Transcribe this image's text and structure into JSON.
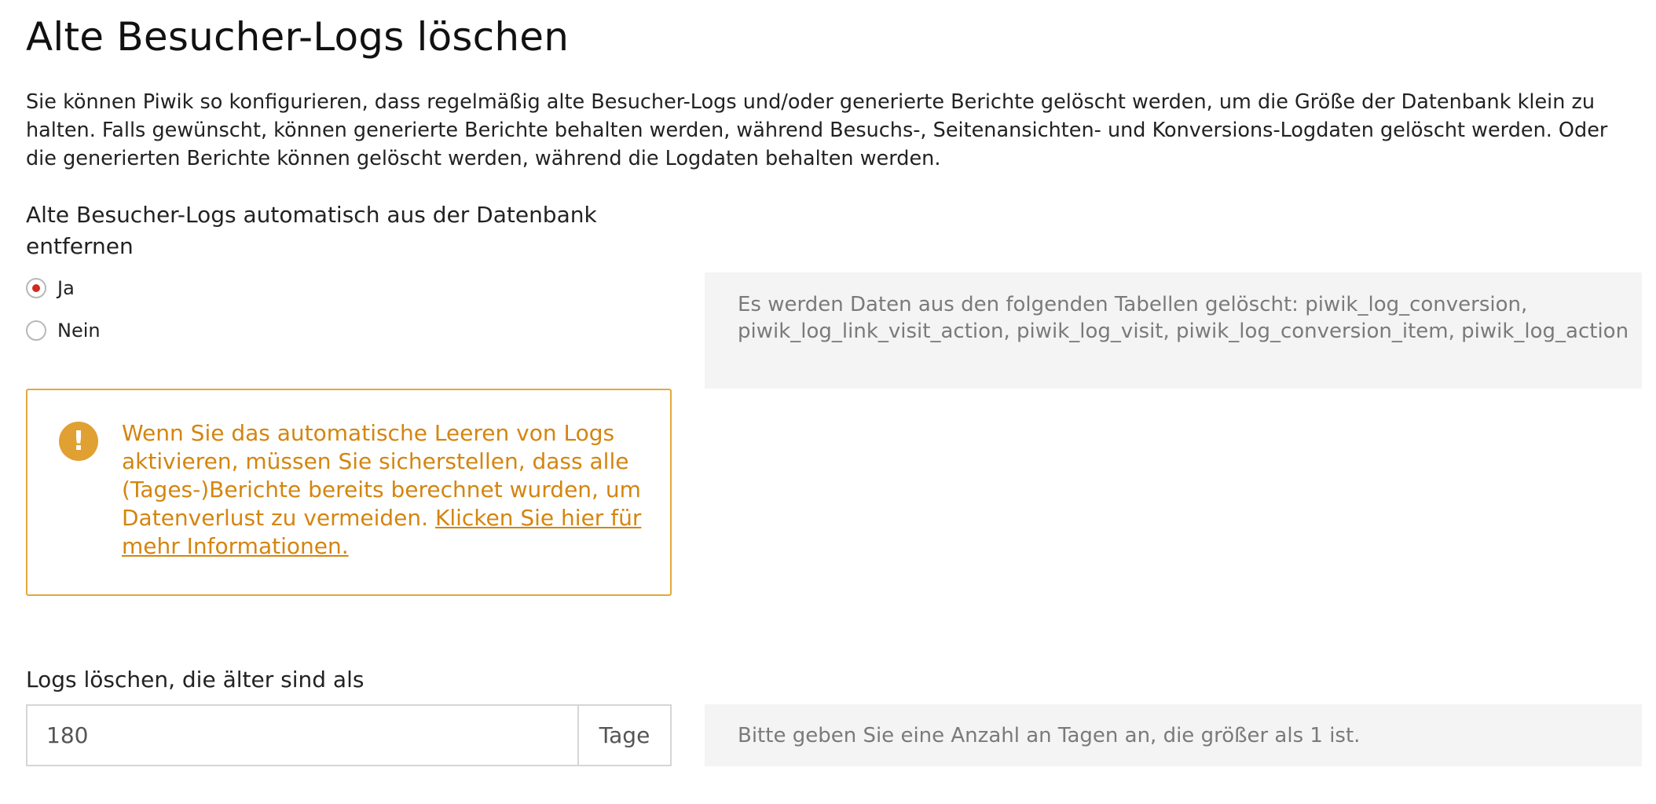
{
  "page": {
    "title": "Alte Besucher-Logs löschen",
    "intro": "Sie können Piwik so konfigurieren, dass regelmäßig alte Besucher-Logs und/oder generierte Berichte gelöscht werden, um die Größe der Datenbank klein zu halten. Falls gewünscht, können generierte Berichte behalten werden, während Besuchs-, Seitenansichten- und Konversions-Logdaten gelöscht werden. Oder die generierten Berichte können gelöscht werden, während die Logdaten behalten werden."
  },
  "delete_logs": {
    "label": "Alte Besucher-Logs automatisch aus der Datenbank entfernen",
    "options": [
      {
        "label": "Ja",
        "selected": true
      },
      {
        "label": "Nein",
        "selected": false
      }
    ],
    "tables_info": "Es werden Daten aus den folgenden Tabellen gelöscht: piwik_log_conversion, piwik_log_link_visit_action, piwik_log_visit, piwik_log_conversion_item, piwik_log_action"
  },
  "warning": {
    "icon": "exclamation-icon",
    "text": "Wenn Sie das automatische Leeren von Logs aktivieren, müssen Sie sicherstellen, dass alle (Tages-)Berichte bereits berechnet wurden, um Datenverlust zu vermeiden.",
    "link": "Klicken Sie hier für mehr Informationen."
  },
  "older_than": {
    "label": "Logs löschen, die älter sind als",
    "value": "180",
    "unit": "Tage",
    "help": "Bitte geben Sie eine Anzahl an Tagen an, die größer als 1 ist."
  },
  "colors": {
    "warning": "#d4850f",
    "warning_icon_bg": "#e1a032",
    "radio_selected": "#d4291f",
    "info_bg": "#f4f4f4"
  }
}
